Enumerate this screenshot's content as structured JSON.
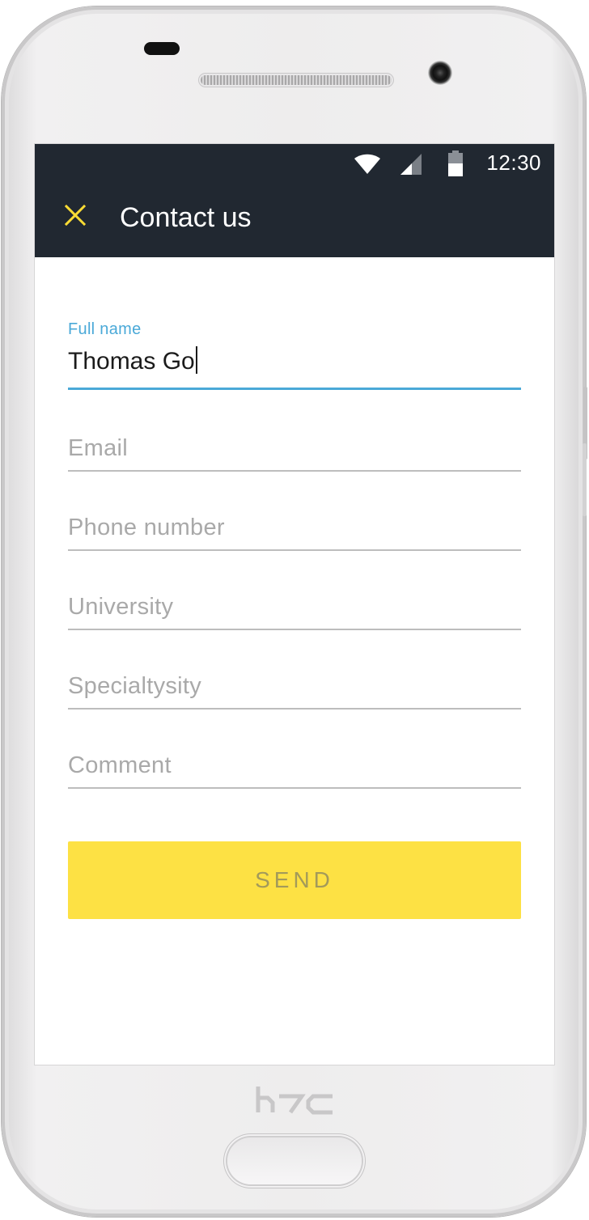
{
  "status_bar": {
    "time": "12:30",
    "icons": [
      "wifi-icon",
      "cell-signal-icon",
      "battery-icon"
    ]
  },
  "toolbar": {
    "close_icon": "close-icon",
    "title": "Contact us"
  },
  "form": {
    "full_name": {
      "label": "Full name",
      "value": "Thomas Go"
    },
    "email": {
      "placeholder": "Email"
    },
    "phone": {
      "placeholder": "Phone number"
    },
    "university": {
      "placeholder": "University"
    },
    "specialty": {
      "placeholder": "Specialtysity"
    },
    "comment": {
      "placeholder": "Comment"
    }
  },
  "send_button": {
    "label": "SEND"
  },
  "device": {
    "brand": "htc"
  },
  "colors": {
    "app_bar": "#212831",
    "accent_blue": "#4aa9d8",
    "button_yellow": "#fde144",
    "close_icon": "#fbdc34"
  }
}
